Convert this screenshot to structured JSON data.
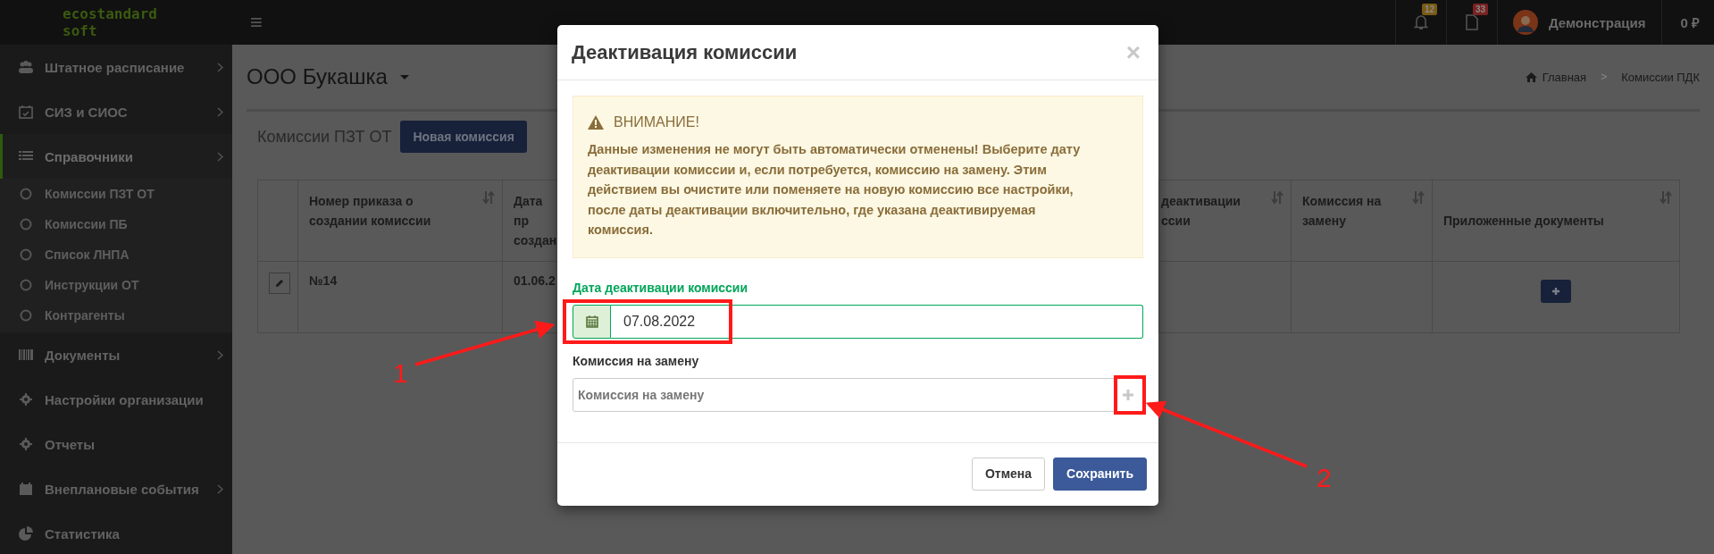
{
  "topbar": {
    "logo_line1": "ecostandard",
    "logo_line2": "soft",
    "menu_icon": "≡",
    "notifications": [
      {
        "kind": "bell",
        "count": "12",
        "color": "#7a5a14"
      },
      {
        "kind": "document",
        "count": "33",
        "color": "#7a2222"
      }
    ],
    "user": "Демонстрация",
    "balance": "0 ₽"
  },
  "sidebar": {
    "items": [
      {
        "label": "Штатное расписание",
        "expandable": true,
        "selected": false
      },
      {
        "label": "СИЗ и СИОС",
        "expandable": true,
        "selected": false
      },
      {
        "label": "Справочники",
        "expandable": true,
        "selected": true,
        "children": [
          {
            "label": "Комиссии ПЗТ ОТ"
          },
          {
            "label": "Комиссии ПБ"
          },
          {
            "label": "Список ЛНПА"
          },
          {
            "label": "Инструкции ОТ"
          },
          {
            "label": "Контрагенты"
          }
        ]
      },
      {
        "label": "Документы",
        "expandable": true,
        "selected": false
      },
      {
        "label": "Настройки организации",
        "expandable": false,
        "selected": false
      },
      {
        "label": "Отчеты",
        "expandable": false,
        "selected": false
      },
      {
        "label": "Внеплановые события",
        "expandable": true,
        "selected": false
      },
      {
        "label": "Статистика",
        "expandable": false,
        "selected": false
      }
    ]
  },
  "page": {
    "title": "ООО Букашка",
    "breadcrumb": [
      "Главная",
      "Комиссии ПДК"
    ],
    "breadcrumb_separator": ">"
  },
  "panel": {
    "title": "Комиссии ПЗТ ОТ",
    "new_button": "Новая комиссия",
    "table": {
      "columns": [
        {
          "sortable": false
        },
        {
          "label": "Номер приказа о\nсоздании комиссии",
          "sortable": true
        },
        {
          "label": "Дата пр\nсоздан",
          "sortable": false
        },
        {
          "sortable": false
        },
        {
          "label": "деактивации\nссии",
          "sortable": true
        },
        {
          "label": "Комиссия на\nзамену",
          "sortable": true
        },
        {
          "label": "Приложенные документы",
          "sortable": true
        }
      ],
      "rows": [
        {
          "cells": [
            "",
            "№14",
            "01.06.2"
          ]
        }
      ]
    }
  },
  "modal": {
    "title": "Деактивация комиссии",
    "close": "×",
    "alert": {
      "title": "ВНИМАНИЕ!",
      "text": "Данные изменения не могут быть автоматически отменены! Выберите дату деактивации комиссии и, если потребуется, комиссию на замену. Этим действием вы очистите или поменяете на новую комиссию все настройки, после даты деактивации включительно, где указана деактивируемая комиссия."
    },
    "fields": [
      {
        "kind": "date",
        "label": "Дата деактивации комиссии",
        "value": "07.08.2022",
        "valid": true
      },
      {
        "kind": "select",
        "label": "Комиссия на замену",
        "placeholder": "Комиссия на замену",
        "valid": false
      }
    ],
    "buttons": [
      {
        "label": "Отмена",
        "kind": "default"
      },
      {
        "label": "Сохранить",
        "kind": "primary"
      }
    ]
  },
  "annotations": [
    {
      "label": "1"
    },
    {
      "label": "2"
    }
  ]
}
